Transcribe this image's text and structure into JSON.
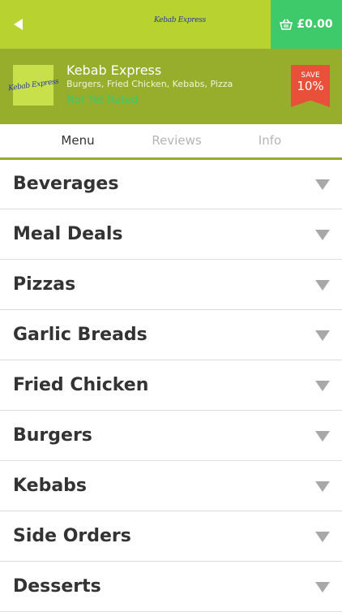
{
  "header": {
    "logo_text": "Kebab Express",
    "basket_total": "£0.00"
  },
  "restaurant": {
    "name": "Kebab Express",
    "cuisines": "Burgers, Fried Chicken, Kebabs, Pizza",
    "rating": "Not Yet Rated",
    "offer": {
      "label": "SAVE",
      "value": "10%"
    }
  },
  "tabs": [
    {
      "label": "Menu",
      "active": true
    },
    {
      "label": "Reviews",
      "active": false
    },
    {
      "label": "Info",
      "active": false
    }
  ],
  "categories": [
    "Beverages",
    "Meal Deals",
    "Pizzas",
    "Garlic Breads",
    "Fried Chicken",
    "Burgers",
    "Kebabs",
    "Side Orders",
    "Desserts"
  ],
  "colors": {
    "topbar": "#b8d230",
    "basket": "#3ec96b",
    "restaurant_bar": "#97ad2c",
    "save_badge": "#e8503a"
  }
}
